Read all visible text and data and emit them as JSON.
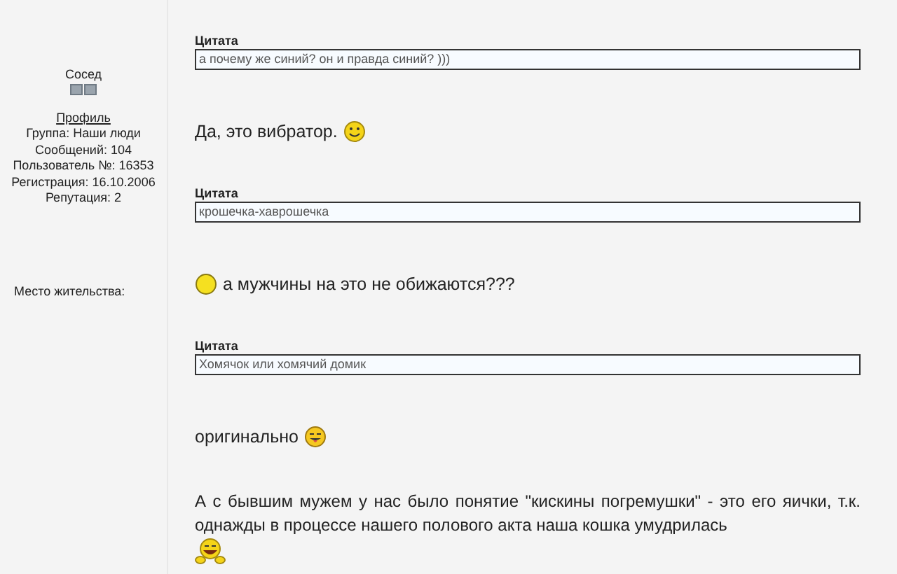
{
  "author": {
    "name": "Сосед",
    "profile_link": "Профиль",
    "stats": [
      "Группа: Наши люди",
      "Сообщений: 104",
      "Пользователь №: 16353",
      "Регистрация: 16.10.2006",
      "Репутация: 2"
    ],
    "location_label": "Место жительства:"
  },
  "blocks": [
    {
      "kind": "quote",
      "label": "Цитата",
      "text": "а почему же синий? он и правда синий? )))"
    },
    {
      "kind": "line",
      "parts": [
        {
          "kind": "text",
          "text": "Да, это вибратор."
        },
        {
          "kind": "smile"
        }
      ]
    },
    {
      "kind": "quote",
      "label": "Цитата",
      "text": "крошечка-хаврошечка"
    },
    {
      "kind": "line",
      "parts": [
        {
          "kind": "plain-face"
        },
        {
          "kind": "text",
          "text": "а мужчины на это не обижаются???"
        }
      ]
    },
    {
      "kind": "quote",
      "label": "Цитата",
      "text": "Хомячок или хомячий домик"
    },
    {
      "kind": "line",
      "parts": [
        {
          "kind": "text",
          "text": "оригинально"
        },
        {
          "kind": "tongue"
        }
      ]
    },
    {
      "kind": "paragraph",
      "parts": [
        {
          "kind": "text",
          "text": "А с бывшим мужем у нас было понятие \"кискины погремушки\" - это его яички, т.к. однажды в процессе нашего полового акта наша кошка умудрилась"
        },
        {
          "kind": "laugh"
        }
      ]
    }
  ]
}
